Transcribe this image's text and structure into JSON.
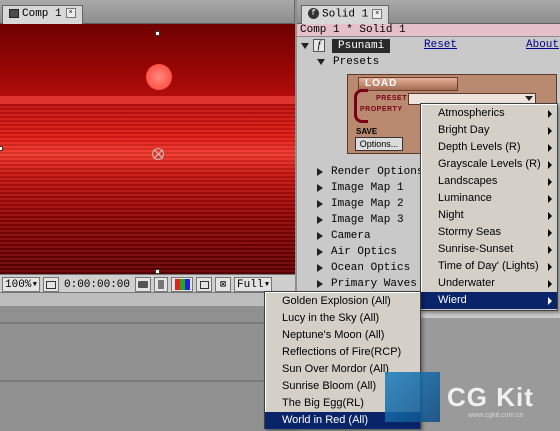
{
  "comp_window": {
    "tab_title": "Comp 1",
    "tab_close": "×",
    "zoom": "100%",
    "timecode": "0:00:00:00",
    "resolution": "Full"
  },
  "effect_controls": {
    "tab_title": "Solid 1",
    "tab_close": "×",
    "subtitle": "Comp 1 * Solid 1",
    "fx_glyph": "f",
    "effect_name": "Psunami",
    "reset_label": "Reset",
    "about_label": "About",
    "presets_label": "Presets",
    "load_label": "LOAD",
    "preset_label": "PRESET",
    "property_label": "PROPERTY",
    "save_label": "SAVE",
    "options_label": "Options...",
    "groups": [
      "Render Options",
      "Image Map 1",
      "Image Map 2",
      "Image Map 3",
      "Camera",
      "Air Optics",
      "Ocean Optics",
      "Primary Waves"
    ]
  },
  "preset_menu": {
    "items": [
      {
        "label": "Atmospherics",
        "submenu": true,
        "selected": false
      },
      {
        "label": "Bright Day",
        "submenu": true,
        "selected": false
      },
      {
        "label": "Depth Levels (R)",
        "submenu": true,
        "selected": false
      },
      {
        "label": "Grayscale Levels (R)",
        "submenu": true,
        "selected": false
      },
      {
        "label": "Landscapes",
        "submenu": true,
        "selected": false
      },
      {
        "label": "Luminance",
        "submenu": true,
        "selected": false
      },
      {
        "label": "Night",
        "submenu": true,
        "selected": false
      },
      {
        "label": "Stormy Seas",
        "submenu": true,
        "selected": false
      },
      {
        "label": "Sunrise-Sunset",
        "submenu": true,
        "selected": false
      },
      {
        "label": "Time of Day' (Lights)",
        "submenu": true,
        "selected": false
      },
      {
        "label": "Underwater",
        "submenu": true,
        "selected": false
      },
      {
        "label": "Wierd",
        "submenu": true,
        "selected": true
      }
    ]
  },
  "wierd_submenu": {
    "items": [
      {
        "label": "Golden Explosion (All)",
        "selected": false
      },
      {
        "label": "Lucy in the Sky (All)",
        "selected": false
      },
      {
        "label": "Neptune's Moon (All)",
        "selected": false
      },
      {
        "label": "Reflections of Fire(RCP)",
        "selected": false
      },
      {
        "label": "Sun Over Mordor (All)",
        "selected": false
      },
      {
        "label": "Sunrise Bloom (All)",
        "selected": false
      },
      {
        "label": "The Big Egg(RL)",
        "selected": false
      },
      {
        "label": "World in Red (All)",
        "selected": true
      }
    ]
  },
  "watermark": {
    "text": "CG Kit",
    "url": "www.cgkit.com.cn"
  }
}
